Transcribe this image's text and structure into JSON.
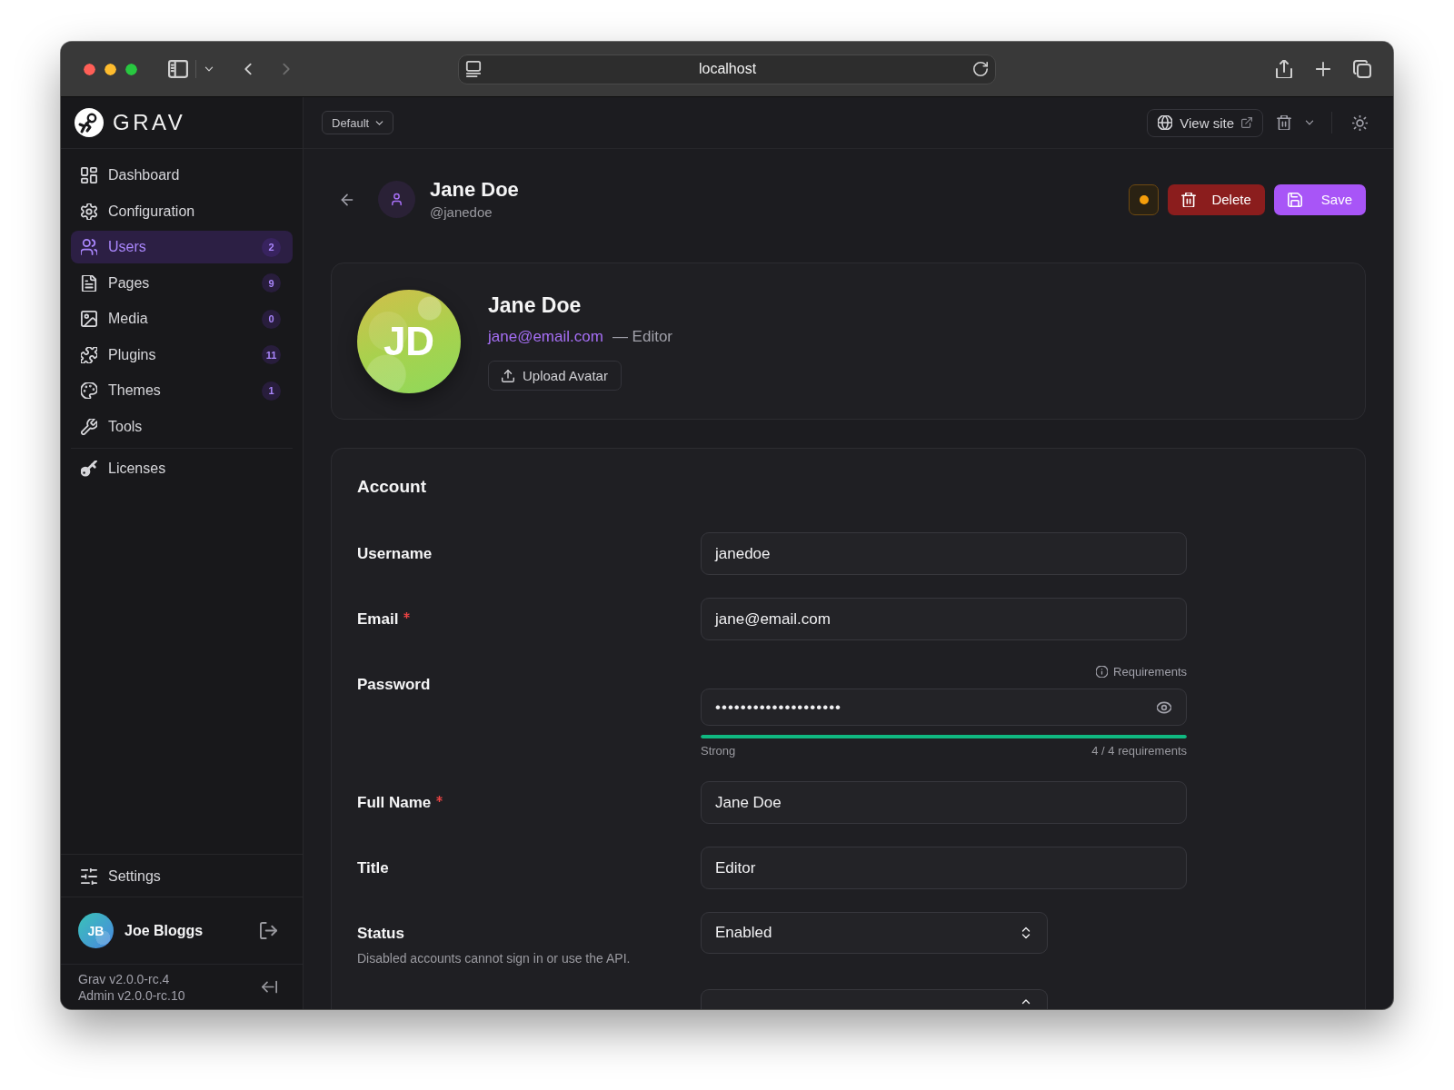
{
  "browser": {
    "address": "localhost",
    "forward_disabled": true
  },
  "sidebar": {
    "logo": "GRAV",
    "items": [
      {
        "label": "Dashboard",
        "selected": false
      },
      {
        "label": "Configuration",
        "selected": false
      },
      {
        "label": "Users",
        "badge": "2",
        "selected": true
      },
      {
        "label": "Pages",
        "badge": "9",
        "selected": false
      },
      {
        "label": "Media",
        "badge": "0",
        "selected": false
      },
      {
        "label": "Plugins",
        "badge": "11",
        "selected": false
      },
      {
        "label": "Themes",
        "badge": "1",
        "selected": false
      },
      {
        "label": "Tools",
        "selected": false
      }
    ],
    "extra_items": [
      {
        "label": "Licenses",
        "selected": false
      }
    ],
    "settings": {
      "label": "Settings",
      "selected": false
    },
    "user": {
      "initials": "JB",
      "name": "Joe Bloggs"
    },
    "versions": [
      "Grav v2.0.0-rc.4",
      "Admin v2.0.0-rc.10"
    ]
  },
  "topbar": {
    "environment": "Default",
    "view_site": "View site"
  },
  "header": {
    "name": "Jane Doe",
    "handle": "@janedoe",
    "actions": [
      {
        "kind": "status"
      },
      {
        "kind": "delete",
        "label": "Delete"
      },
      {
        "kind": "save",
        "label": "Save"
      }
    ]
  },
  "profile": {
    "initials": "JD",
    "name": "Jane Doe",
    "email": "jane@email.com",
    "role": "— Editor",
    "upload": "Upload Avatar"
  },
  "account": {
    "title": "Account",
    "fields": [
      {
        "kind": "text",
        "label": "Username",
        "required": false,
        "value": "janedoe"
      },
      {
        "kind": "text",
        "label": "Email",
        "required": true,
        "value": "jane@email.com"
      },
      {
        "kind": "password",
        "label": "Password",
        "required": false,
        "value": "••••••••••••••••••••",
        "requirements": "Requirements",
        "strength": {
          "level": 1,
          "label": "Strong",
          "detail": "4 / 4 requirements"
        }
      },
      {
        "kind": "text",
        "label": "Full Name",
        "required": true,
        "value": "Jane Doe"
      },
      {
        "kind": "text",
        "label": "Title",
        "required": false,
        "value": "Editor"
      },
      {
        "kind": "select",
        "label": "Status",
        "required": false,
        "value": "Enabled",
        "help": "Disabled accounts cannot sign in or use the API."
      },
      {
        "kind": "select"
      }
    ]
  }
}
